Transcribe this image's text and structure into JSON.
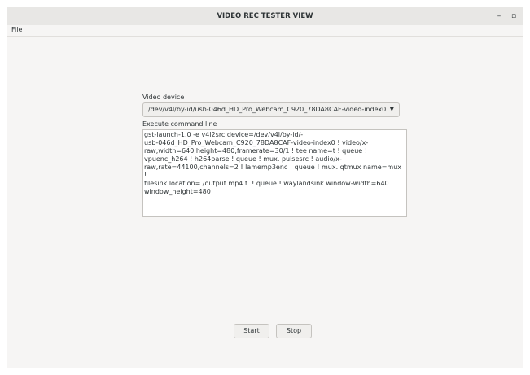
{
  "window": {
    "title": "VIDEO REC TESTER VIEW",
    "minimize_glyph": "–",
    "maximize_glyph": "▫"
  },
  "menubar": {
    "items": [
      {
        "label": "File"
      }
    ]
  },
  "form": {
    "video_device_label": "Video device",
    "video_device_value": "/dev/v4l/by-id/usb-046d_HD_Pro_Webcam_C920_78DA8CAF-video-index0",
    "command_label": "Execute command line",
    "command_value": "gst-launch-1.0 -e v4l2src device=/dev/v4l/by-id/-\nusb-046d_HD_Pro_Webcam_C920_78DA8CAF-video-index0 ! video/x-\nraw,width=640,height=480,framerate=30/1 ! tee name=t ! queue !\nvpuenc_h264 ! h264parse ! queue ! mux. pulsesrc ! audio/x-\nraw,rate=44100,channels=2 ! lamemp3enc ! queue ! mux. qtmux name=mux !\nfilesink location=./output.mp4 t. ! queue ! waylandsink window-width=640\nwindow_height=480"
  },
  "buttons": {
    "start_label": "Start",
    "stop_label": "Stop"
  }
}
